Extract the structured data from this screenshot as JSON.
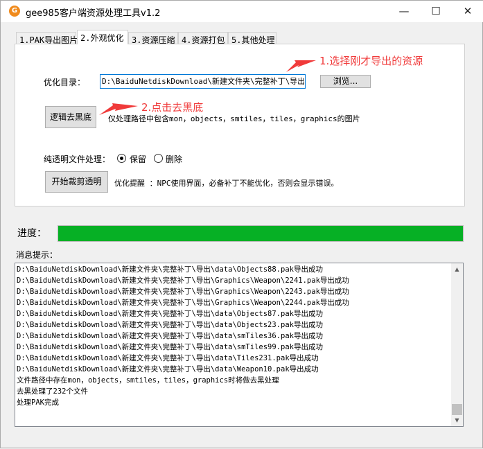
{
  "window": {
    "title": "gee985客户端资源处理工具v1.2",
    "minimize": "—",
    "maximize": "☐",
    "close": "✕",
    "logo_icon": "app-logo-icon"
  },
  "tabs": [
    {
      "label": "1.PAK导出图片"
    },
    {
      "label": "2.外观优化",
      "active": true
    },
    {
      "label": "3.资源压缩"
    },
    {
      "label": "4.资源打包"
    },
    {
      "label": "5.其他处理"
    }
  ],
  "panel": {
    "dir_label": "优化目录：",
    "dir_value": "D:\\BaiduNetdiskDownload\\新建文件夹\\完整补丁\\导出",
    "browse_label": "浏览...",
    "deblack_label": "逻辑去黑底",
    "deblack_hint": "仅处理路径中包含mon，objects，smtiles，tiles，graphics的图片",
    "transparent_label": "纯透明文件处理：",
    "radio_keep": "保留",
    "radio_delete": "删除",
    "selected": "保留",
    "crop_label": "开始裁剪透明",
    "crop_hint": "优化提醒 ：NPC使用界面，必备补丁不能优化，否则会显示错误。"
  },
  "annotations": {
    "step1": "1.选择刚才导出的资源",
    "step2": "2.点击去黑底",
    "color": "#f03a3a"
  },
  "progress": {
    "label": "进度：",
    "value_percent": 100,
    "color": "#06b025"
  },
  "log": {
    "label": "消息提示：",
    "lines": [
      "D:\\BaiduNetdiskDownload\\新建文件夹\\完整补丁\\导出\\data\\Objects88.pak导出成功",
      "D:\\BaiduNetdiskDownload\\新建文件夹\\完整补丁\\导出\\Graphics\\Weapon\\2241.pak导出成功",
      "D:\\BaiduNetdiskDownload\\新建文件夹\\完整补丁\\导出\\Graphics\\Weapon\\2243.pak导出成功",
      "D:\\BaiduNetdiskDownload\\新建文件夹\\完整补丁\\导出\\Graphics\\Weapon\\2244.pak导出成功",
      "D:\\BaiduNetdiskDownload\\新建文件夹\\完整补丁\\导出\\data\\Objects87.pak导出成功",
      "D:\\BaiduNetdiskDownload\\新建文件夹\\完整补丁\\导出\\data\\Objects23.pak导出成功",
      "D:\\BaiduNetdiskDownload\\新建文件夹\\完整补丁\\导出\\data\\smTiles36.pak导出成功",
      "D:\\BaiduNetdiskDownload\\新建文件夹\\完整补丁\\导出\\data\\smTiles99.pak导出成功",
      "D:\\BaiduNetdiskDownload\\新建文件夹\\完整补丁\\导出\\data\\Tiles231.pak导出成功",
      "D:\\BaiduNetdiskDownload\\新建文件夹\\完整补丁\\导出\\data\\Weapon10.pak导出成功",
      "文件路径中存在mon，objects，smtiles，tiles，graphics时将做去黑处理",
      "去黑处理了232个文件",
      "处理PAK完成"
    ],
    "scroll_up": "▲",
    "scroll_down": "▼"
  }
}
